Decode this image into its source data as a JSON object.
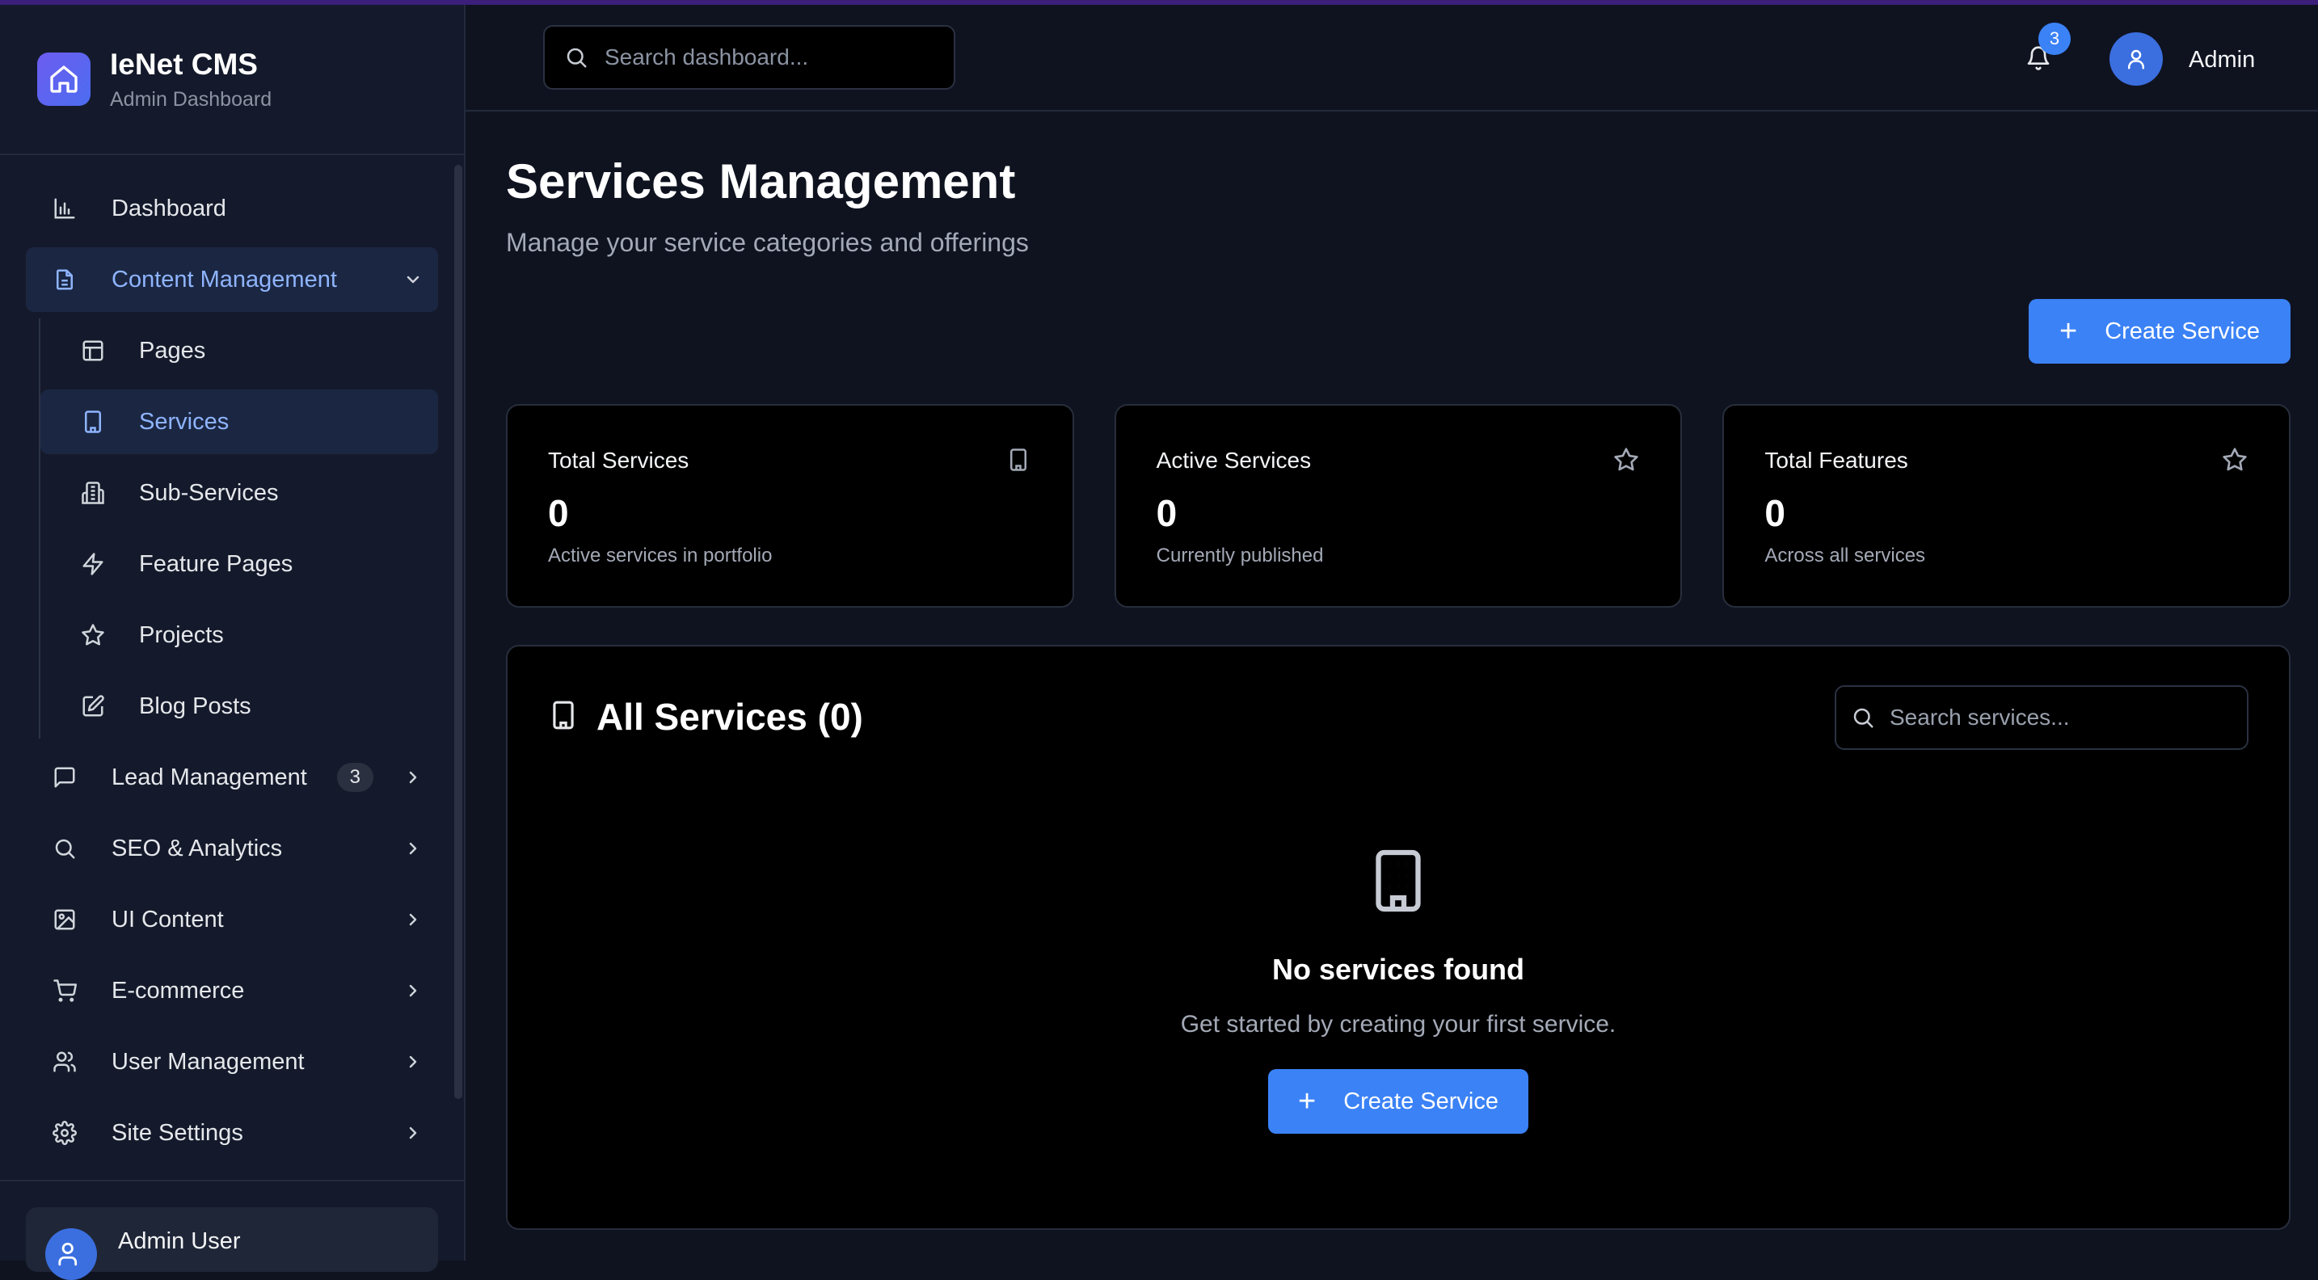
{
  "brand": {
    "title": "IeNet CMS",
    "subtitle": "Admin Dashboard"
  },
  "sidebar": {
    "items": [
      {
        "label": "Dashboard",
        "icon": "bar-chart-icon"
      },
      {
        "label": "Content Management",
        "icon": "document-icon",
        "expanded": true
      },
      {
        "label": "Lead Management",
        "icon": "message-icon",
        "badge": "3"
      },
      {
        "label": "SEO & Analytics",
        "icon": "search-icon"
      },
      {
        "label": "UI Content",
        "icon": "image-icon"
      },
      {
        "label": "E-commerce",
        "icon": "cart-icon"
      },
      {
        "label": "User Management",
        "icon": "users-icon"
      },
      {
        "label": "Site Settings",
        "icon": "gear-icon"
      }
    ],
    "content_sub": [
      {
        "label": "Pages",
        "icon": "layout-icon"
      },
      {
        "label": "Services",
        "icon": "building-icon",
        "active": true
      },
      {
        "label": "Sub-Services",
        "icon": "buildings-icon"
      },
      {
        "label": "Feature Pages",
        "icon": "lightning-icon"
      },
      {
        "label": "Projects",
        "icon": "star-icon"
      },
      {
        "label": "Blog Posts",
        "icon": "edit-icon"
      }
    ],
    "user": {
      "name": "Admin User"
    }
  },
  "topbar": {
    "search_placeholder": "Search dashboard...",
    "notification_count": "3",
    "user_name": "Admin"
  },
  "page": {
    "title": "Services Management",
    "subtitle": "Manage your service categories and offerings",
    "create_label": "Create Service"
  },
  "stats": [
    {
      "label": "Total Services",
      "value": "0",
      "desc": "Active services in portfolio",
      "icon": "building-icon"
    },
    {
      "label": "Active Services",
      "value": "0",
      "desc": "Currently published",
      "icon": "star-icon"
    },
    {
      "label": "Total Features",
      "value": "0",
      "desc": "Across all services",
      "icon": "star-icon"
    }
  ],
  "panel": {
    "title": "All Services (0)",
    "search_placeholder": "Search services...",
    "empty_title": "No services found",
    "empty_text": "Get started by creating your first service.",
    "empty_button": "Create Service"
  },
  "colors": {
    "accent": "#3b82f6",
    "active_bg": "#1b2742",
    "active_text": "#8fb4ff",
    "background": "#0f1320"
  }
}
